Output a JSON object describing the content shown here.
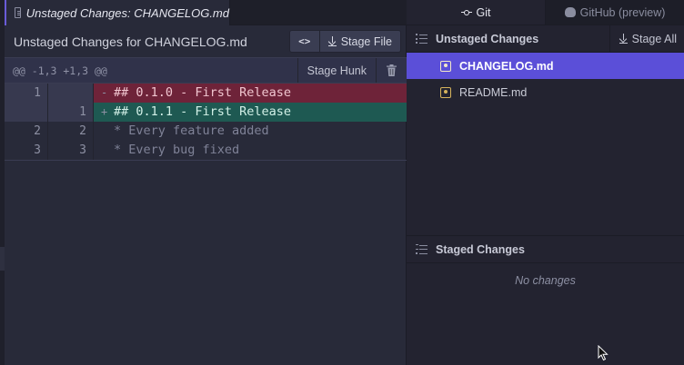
{
  "editor": {
    "tab_title": "Unstaged Changes: CHANGELOG.md",
    "header_title": "Unstaged Changes for CHANGELOG.md",
    "code_toggle_label": "<>",
    "stage_file_label": "Stage File",
    "hunk": {
      "range": "@@ -1,3 +1,3 @@",
      "stage_hunk_label": "Stage Hunk"
    },
    "diff_lines": [
      {
        "type": "del",
        "old": "1",
        "new": "",
        "sign": "-",
        "text": "## 0.1.0 - First Release"
      },
      {
        "type": "add",
        "old": "",
        "new": "1",
        "sign": "+",
        "text": "## 0.1.1 - First Release"
      },
      {
        "type": "ctx",
        "old": "2",
        "new": "2",
        "sign": "",
        "text": "* Every feature added"
      },
      {
        "type": "ctx",
        "old": "3",
        "new": "3",
        "sign": "",
        "text": "* Every bug fixed"
      }
    ]
  },
  "git_panel": {
    "tabs": [
      {
        "label": "Git",
        "icon": "git-commit-icon"
      },
      {
        "label": "GitHub (preview)",
        "icon": "github-icon"
      }
    ],
    "unstaged": {
      "title": "Unstaged Changes",
      "stage_all_label": "Stage All",
      "files": [
        {
          "name": "CHANGELOG.md",
          "selected": true
        },
        {
          "name": "README.md",
          "selected": false
        }
      ]
    },
    "staged": {
      "title": "Staged Changes",
      "empty_text": "No changes"
    }
  },
  "colors": {
    "accent": "#5b4fd8",
    "deleted_line": "#6e2339",
    "added_line": "#1e5952",
    "modified_icon": "#d6b35c"
  }
}
